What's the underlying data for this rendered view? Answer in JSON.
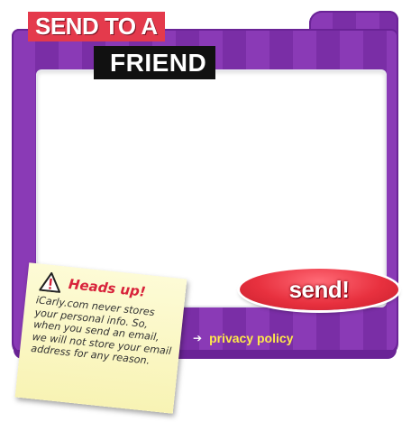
{
  "title": {
    "line1": "SEND TO A",
    "line2": "FRIEND"
  },
  "send_button": {
    "label": "send!"
  },
  "privacy_link": {
    "label": "privacy policy"
  },
  "note": {
    "icon": "warning-icon",
    "heading": "Heads up!",
    "body": "iCarly.com never stores your personal info. So, when you send an email, we will not store your email address for any reason."
  },
  "colors": {
    "frame_purple": "#8a3ab6",
    "title_red": "#e43a4c",
    "button_red": "#e8313f",
    "link_yellow": "#ffe84a",
    "note_yellow": "#f8f3b4"
  }
}
